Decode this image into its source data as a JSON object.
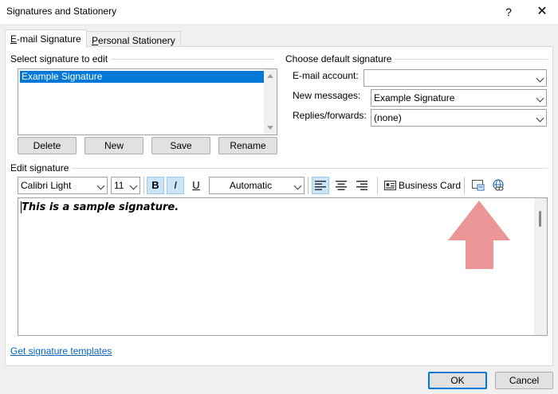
{
  "window": {
    "title": "Signatures and Stationery",
    "help_glyph": "?",
    "close_glyph": "✕"
  },
  "tabs": [
    {
      "label": "E-mail Signature",
      "accel_index": 0,
      "active": true
    },
    {
      "label": "Personal Stationery",
      "accel_index": 0,
      "active": false
    }
  ],
  "select_signature": {
    "label": "Select signature to edit",
    "items": [
      "Example Signature"
    ],
    "selected": "Example Signature",
    "buttons": {
      "delete": "Delete",
      "new": "New",
      "save": "Save",
      "rename": "Rename"
    }
  },
  "default_signature": {
    "label": "Choose default signature",
    "email_account_label": "E-mail account:",
    "email_account_value": "",
    "new_messages_label": "New messages:",
    "new_messages_value": "Example Signature",
    "replies_forwards_label": "Replies/forwards:",
    "replies_forwards_value": "(none)"
  },
  "edit_signature": {
    "label": "Edit signature",
    "toolbar": {
      "font_name": "Calibri Light",
      "font_size": "11",
      "bold": "B",
      "italic": "I",
      "underline": "U",
      "color": "Automatic",
      "business_card": "Business Card"
    },
    "content": "This is a sample signature."
  },
  "footer": {
    "templates_link": "Get signature templates",
    "ok": "OK",
    "cancel": "Cancel"
  },
  "colors": {
    "selection": "#0078d7",
    "link": "#0563c1",
    "annotation_arrow": "#e88b8b"
  }
}
